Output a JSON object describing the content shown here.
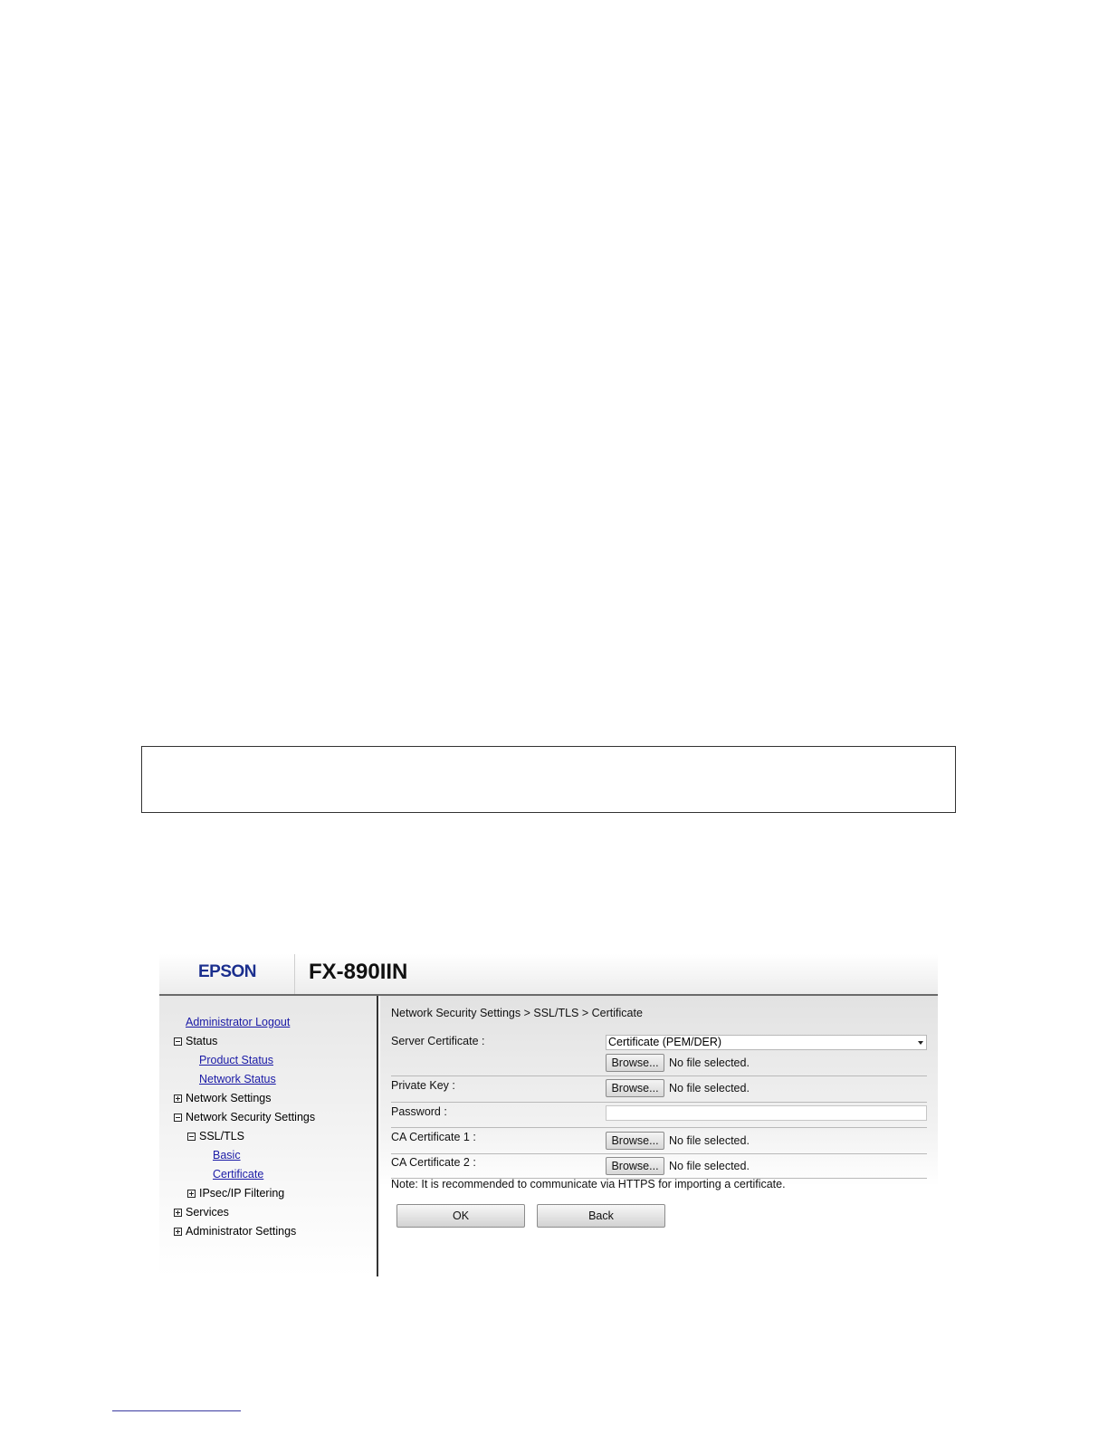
{
  "header": {
    "brand": "EPSON",
    "model": "FX-890IIN"
  },
  "sidebar": {
    "admin_logout": "Administrator Logout",
    "status": "Status",
    "product_status": "Product Status",
    "network_status": "Network Status",
    "network_settings": "Network Settings",
    "network_security_settings": "Network Security Settings",
    "ssl_tls": "SSL/TLS",
    "basic": "Basic",
    "certificate": "Certificate",
    "ipsec": "IPsec/IP Filtering",
    "services": "Services",
    "admin_settings": "Administrator Settings"
  },
  "main": {
    "breadcrumb": "Network Security Settings > SSL/TLS > Certificate",
    "server_certificate": {
      "label": "Server Certificate :",
      "format_selected": "Certificate (PEM/DER)",
      "browse": "Browse...",
      "file_status": "No file selected."
    },
    "private_key": {
      "label": "Private Key :",
      "browse": "Browse...",
      "file_status": "No file selected."
    },
    "password": {
      "label": "Password :",
      "value": ""
    },
    "ca_certificate_1": {
      "label": "CA Certificate 1 :",
      "browse": "Browse...",
      "file_status": "No file selected."
    },
    "ca_certificate_2": {
      "label": "CA Certificate 2 :",
      "browse": "Browse...",
      "file_status": "No file selected."
    },
    "note": "Note: It is recommended to communicate via HTTPS for importing a certificate.",
    "ok_button": "OK",
    "back_button": "Back"
  }
}
